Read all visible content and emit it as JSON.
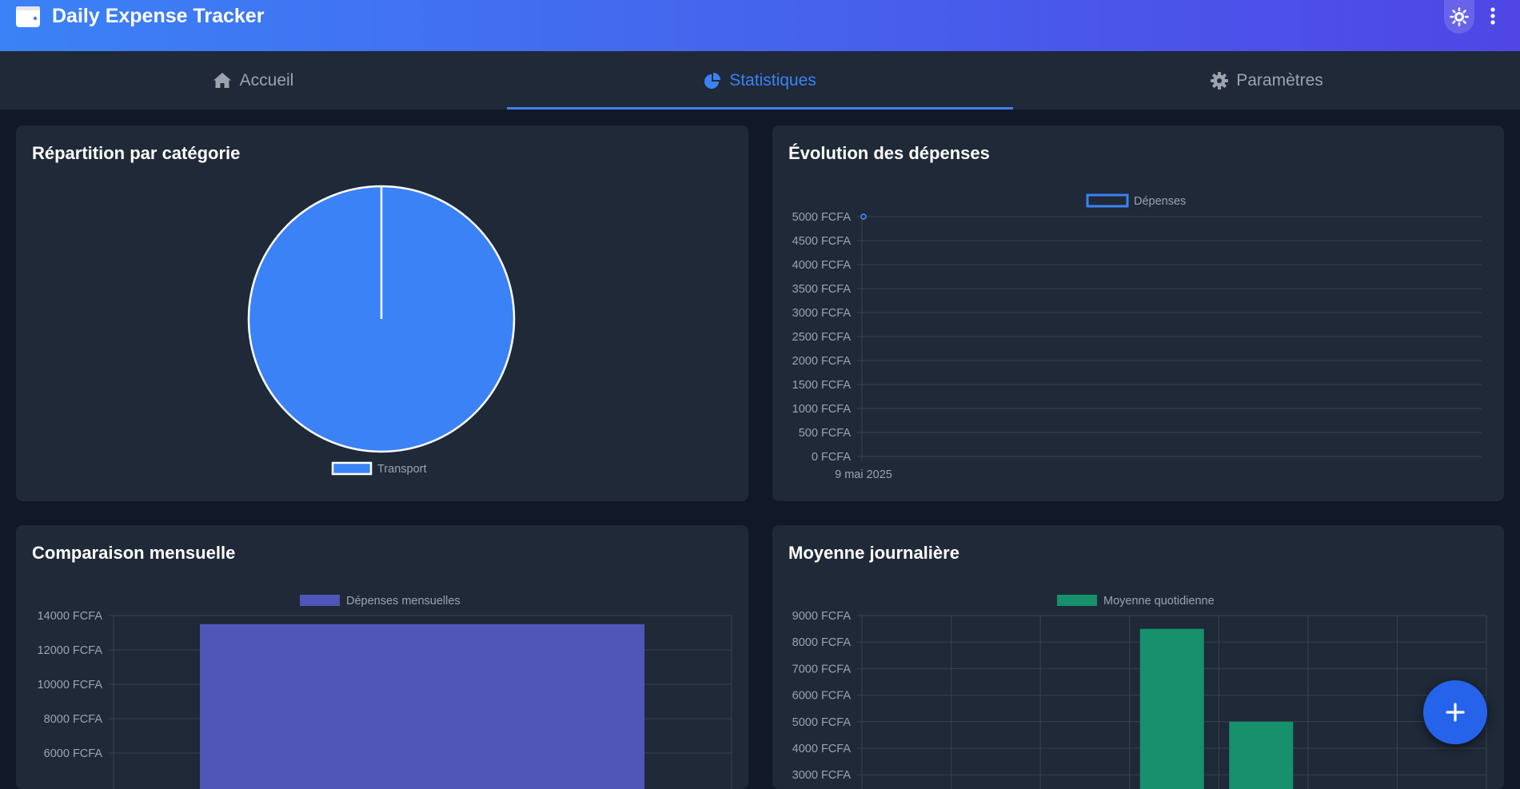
{
  "app": {
    "title": "Daily Expense Tracker"
  },
  "header": {
    "logo_icon": "wallet-icon",
    "theme_icon": "sun-icon",
    "menu_icon": "kebab-menu-icon"
  },
  "tabs": [
    {
      "label": "Accueil",
      "icon": "home-icon",
      "active": false
    },
    {
      "label": "Statistiques",
      "icon": "pie-chart-icon",
      "active": true
    },
    {
      "label": "Paramètres",
      "icon": "gear-icon",
      "active": false
    }
  ],
  "colors": {
    "accent": "#3b82f6",
    "header_start": "#3b82f6",
    "header_end": "#4f46e5",
    "card_bg": "#1f2937",
    "page_bg": "#111827",
    "monthly_bar": "#4f56b8",
    "daily_bar": "#16916b"
  },
  "cards": {
    "category": {
      "title": "Répartition par catégorie"
    },
    "evolution": {
      "title": "Évolution des dépenses"
    },
    "monthly": {
      "title": "Comparaison mensuelle"
    },
    "daily": {
      "title": "Moyenne journalière"
    }
  },
  "fab": {
    "icon": "plus-icon",
    "label": "+"
  },
  "chart_data": [
    {
      "type": "pie",
      "title": "Répartition par catégorie",
      "categories": [
        "Transport"
      ],
      "values": [
        100
      ],
      "colors": [
        "#3b82f6"
      ],
      "legend": "bottom"
    },
    {
      "type": "line",
      "title": "Évolution des dépenses",
      "series": [
        {
          "name": "Dépenses",
          "x": [
            "9 mai 2025"
          ],
          "values": [
            5000
          ]
        }
      ],
      "yticks": [
        "0 FCFA",
        "500 FCFA",
        "1000 FCFA",
        "1500 FCFA",
        "2000 FCFA",
        "2500 FCFA",
        "3000 FCFA",
        "3500 FCFA",
        "4000 FCFA",
        "4500 FCFA",
        "5000 FCFA"
      ],
      "ylim": [
        0,
        5000
      ],
      "grid": true,
      "legend": "top"
    },
    {
      "type": "bar",
      "title": "Comparaison mensuelle",
      "series": [
        {
          "name": "Dépenses mensuelles",
          "values": [
            13500
          ]
        }
      ],
      "yticks": [
        "6000 FCFA",
        "8000 FCFA",
        "10000 FCFA",
        "12000 FCFA",
        "14000 FCFA"
      ],
      "ylim": [
        0,
        14000
      ],
      "grid": true,
      "legend": "top"
    },
    {
      "type": "bar",
      "title": "Moyenne journalière",
      "series": [
        {
          "name": "Moyenne quotidienne",
          "values": [
            0,
            0,
            0,
            8500,
            5000,
            0,
            0
          ]
        }
      ],
      "yticks": [
        "3000 FCFA",
        "4000 FCFA",
        "5000 FCFA",
        "6000 FCFA",
        "7000 FCFA",
        "8000 FCFA",
        "9000 FCFA"
      ],
      "ylim": [
        0,
        9000
      ],
      "grid": true,
      "legend": "top"
    }
  ]
}
